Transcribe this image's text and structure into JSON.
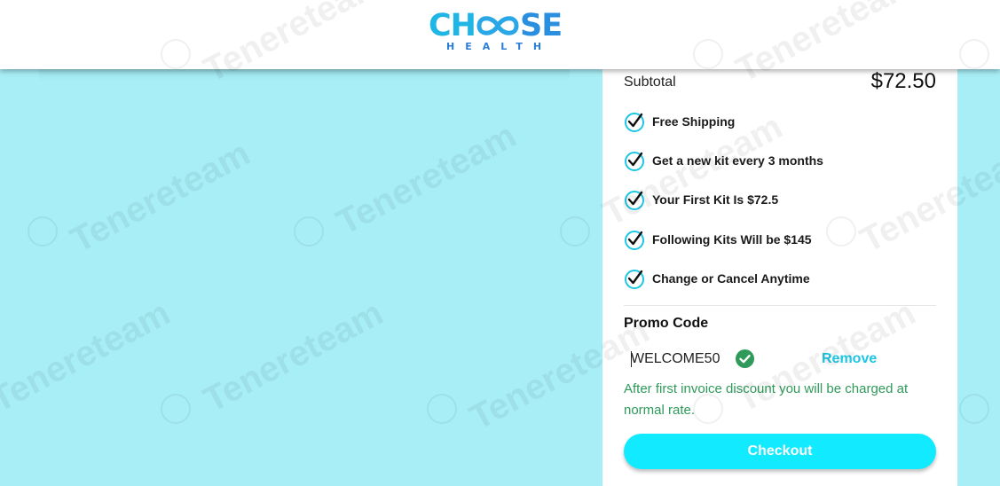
{
  "brand": {
    "word_left": "CH",
    "word_right": "SE",
    "sub": "HEALTH",
    "color_primary": "#1fb5e5",
    "color_secondary": "#2b8fe0"
  },
  "summary": {
    "subtotal_label": "Subtotal",
    "subtotal_value": "$72.50"
  },
  "features": [
    {
      "label": "Free Shipping",
      "icon": "check-circle-icon"
    },
    {
      "label": "Get a new kit every 3 months",
      "icon": "check-circle-icon"
    },
    {
      "label": "Your First Kit Is $72.5",
      "icon": "check-circle-icon"
    },
    {
      "label": "Following Kits Will be $145",
      "icon": "check-circle-icon"
    },
    {
      "label": "Change or Cancel Anytime",
      "icon": "check-circle-icon"
    }
  ],
  "promo": {
    "title": "Promo Code",
    "value": "WELCOME50",
    "valid_icon": "check-circle-filled-icon",
    "remove_label": "Remove",
    "note": "After first invoice discount you will be charged at normal rate."
  },
  "checkout": {
    "label": "Checkout",
    "color": "#12eaff"
  },
  "watermark": {
    "text": "Tenereteam"
  },
  "colors": {
    "background": "#a8eef6",
    "accent": "#1cc6e4",
    "success": "#2f9a5a"
  }
}
